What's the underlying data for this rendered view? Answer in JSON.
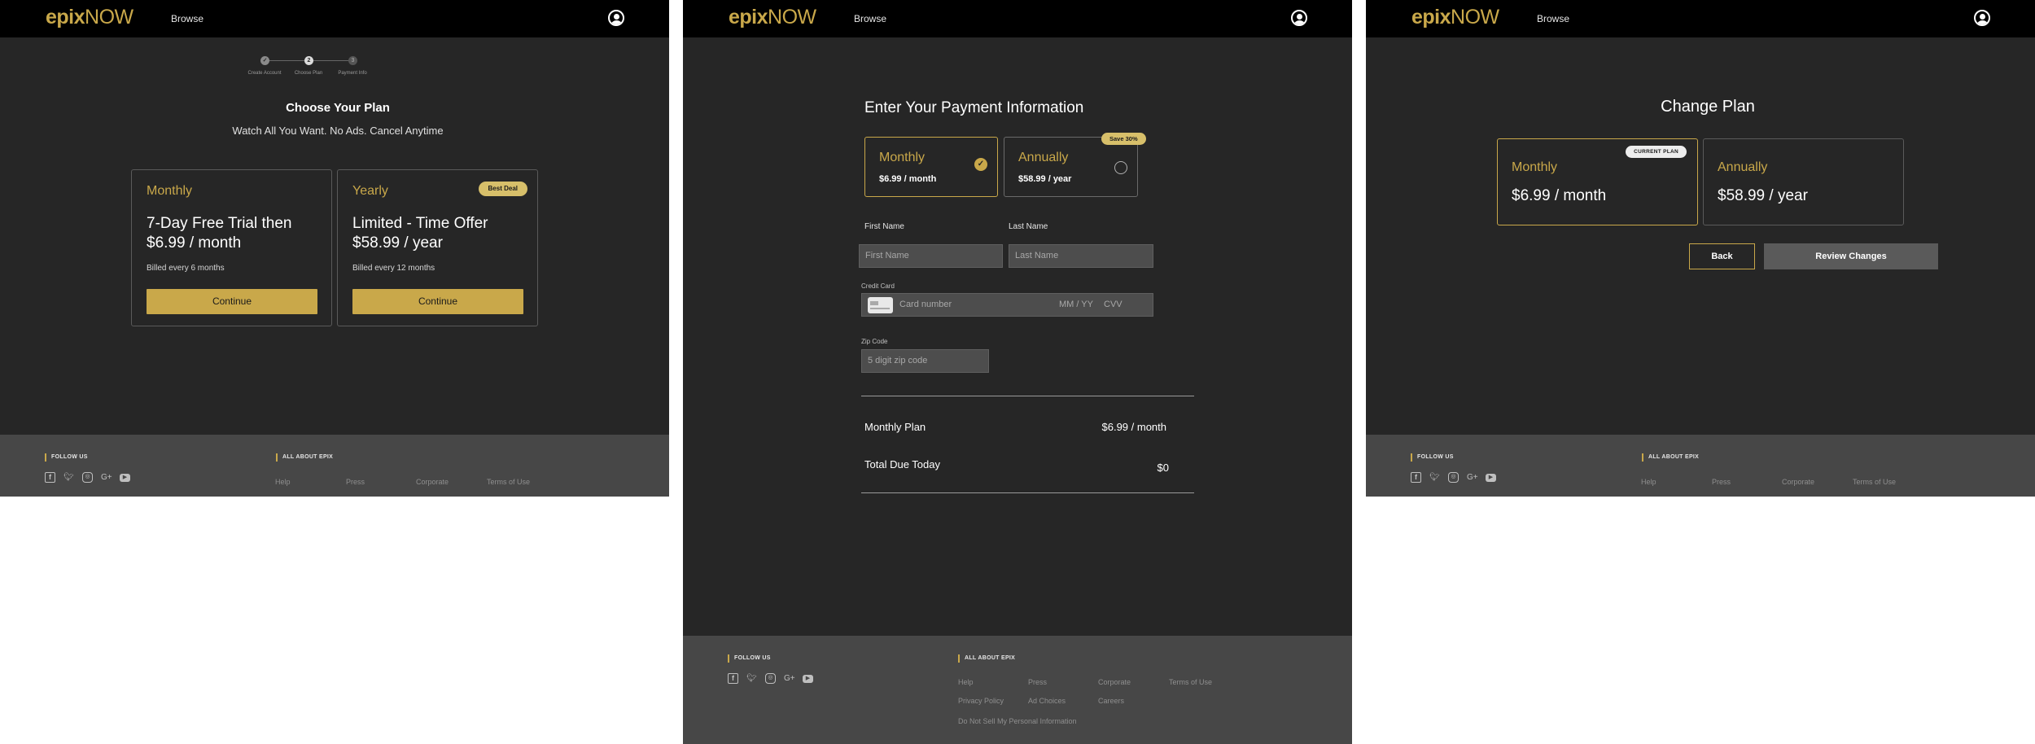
{
  "brand": {
    "logo_bold": "epix",
    "logo_light": "NOW",
    "accent": "#c9a84a",
    "nav_browse": "Browse"
  },
  "footer": {
    "follow_us": "FOLLOW US",
    "all_about": "ALL ABOUT EPIX",
    "social_icons": [
      "facebook-icon",
      "twitter-icon",
      "instagram-icon",
      "google-plus-icon",
      "youtube-icon"
    ],
    "links_row1": [
      "Help",
      "Press",
      "Corporate",
      "Terms of Use"
    ],
    "links_row2": [
      "Privacy Policy",
      "Ad Choices",
      "Careers"
    ],
    "links_row3": [
      "Do Not Sell My Personal Information"
    ]
  },
  "choose_plan": {
    "steps": [
      {
        "label": "Create Account",
        "state": "done",
        "mark": "✓"
      },
      {
        "label": "Choose Plan",
        "state": "current",
        "mark": "2"
      },
      {
        "label": "Payment Info",
        "state": "future",
        "mark": "3"
      }
    ],
    "title": "Choose Your Plan",
    "subtitle": "Watch All You Want. No Ads. Cancel Anytime",
    "plans": [
      {
        "name": "Monthly",
        "offer": "7-Day Free Trial then $6.99 / month",
        "billed": "Billed every 6 months",
        "cta": "Continue"
      },
      {
        "name": "Yearly",
        "offer": "Limited - Time Offer $58.99 / year",
        "billed": "Billed every 12 months",
        "cta": "Continue",
        "badge": "Best Deal"
      }
    ]
  },
  "payment": {
    "title": "Enter Your Payment Information",
    "plans": [
      {
        "name": "Monthly",
        "price": "$6.99 / month",
        "selected": true
      },
      {
        "name": "Annually",
        "price": "$58.99 / year",
        "selected": false,
        "badge": "Save 30%"
      }
    ],
    "first_name_label": "First Name",
    "first_name_placeholder": "First Name",
    "last_name_label": "Last Name",
    "last_name_placeholder": "Last Name",
    "credit_card_label": "Credit Card",
    "card_number_placeholder": "Card number",
    "expiry_placeholder": "MM / YY",
    "cvv_placeholder": "CVV",
    "zip_label": "Zip Code",
    "zip_placeholder": "5 digit zip code",
    "summary": [
      {
        "label": "Monthly Plan",
        "value": "$6.99 / month"
      },
      {
        "label": "Total Due Today",
        "value": "$0"
      }
    ]
  },
  "change_plan": {
    "title": "Change  Plan",
    "plans": [
      {
        "name": "Monthly",
        "price": "$6.99 / month",
        "badge": "CURRENT PLAN",
        "current": true
      },
      {
        "name": "Annually",
        "price": "$58.99 / year",
        "current": false
      }
    ],
    "back": "Back",
    "review": "Review Changes"
  }
}
